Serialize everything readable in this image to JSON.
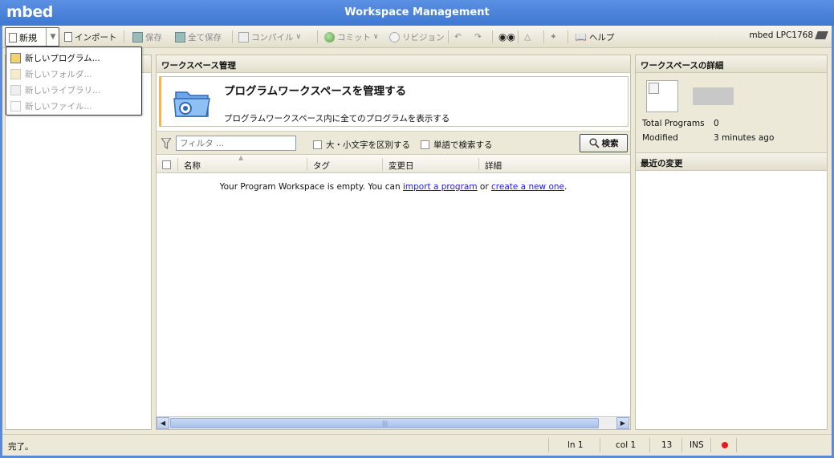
{
  "window": {
    "logo": "mbed",
    "title": "Workspace Management"
  },
  "toolbar": {
    "new": "新規",
    "import": "インポート",
    "save": "保存",
    "save_all": "全て保存",
    "compile": "コンパイル",
    "commit": "コミット",
    "revision": "リビジョン",
    "help": "ヘルプ",
    "device": "mbed LPC1768"
  },
  "new_menu": {
    "items": [
      {
        "label": "新しいプログラム...",
        "enabled": true
      },
      {
        "label": "新しいフォルダ...",
        "enabled": false
      },
      {
        "label": "新しいライブラリ...",
        "enabled": false
      },
      {
        "label": "新しいファイル...",
        "enabled": false
      }
    ]
  },
  "main": {
    "header": "ワークスペース管理",
    "banner_title": "プログラムワークスペースを管理する",
    "banner_subtitle": "プログラムワークスペース内に全てのプログラムを表示する",
    "filter_placeholder": "フィルタ ...",
    "case_sensitive": "大・小文字を区別する",
    "whole_word": "単語で検索する",
    "search_button": "検索",
    "columns": [
      "名称",
      "タグ",
      "変更日",
      "詳細"
    ],
    "empty_prefix": "Your Program Workspace is empty. You can ",
    "empty_link1": "import a program",
    "empty_middle": " or ",
    "empty_link2": "create a new one",
    "empty_suffix": "."
  },
  "details": {
    "header": "ワークスペースの詳細",
    "total_programs_label": "Total Programs",
    "total_programs_value": "0",
    "modified_label": "Modified",
    "modified_value": "3 minutes ago",
    "recent_header": "最近の変更"
  },
  "status": {
    "message": "完了。",
    "line": "ln 1",
    "col": "col 1",
    "num": "13",
    "mode": "INS"
  },
  "colors": {
    "title_bar": "#3f78d2",
    "accent": "#f0b84a",
    "link": "#1a1aee",
    "record": "#e31b1b"
  }
}
